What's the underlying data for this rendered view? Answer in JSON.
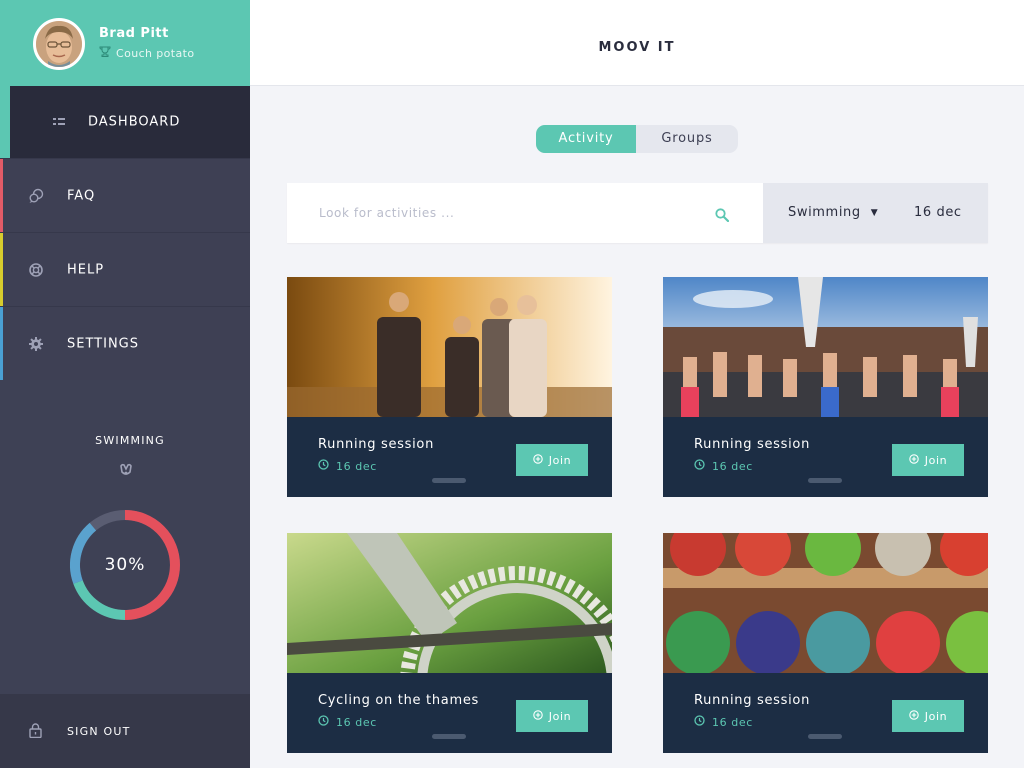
{
  "profile": {
    "name": "Brad Pitt",
    "role": "Couch potato"
  },
  "nav": {
    "dashboard": "DASHBOARD",
    "faq": "FAQ",
    "help": "HELP",
    "settings": "SETTINGS",
    "signout": "SIGN OUT"
  },
  "stats": {
    "title": "SWIMMING",
    "progress_label": "30%",
    "progress": 0.3
  },
  "header": {
    "brand": "MOOV  IT"
  },
  "tabs": {
    "activity": "Activity",
    "groups": "Groups",
    "selected": "Activity"
  },
  "search": {
    "placeholder": "Look for activities ...",
    "value": ""
  },
  "filter": {
    "category": "Swimming",
    "date": "16 dec"
  },
  "cards": [
    {
      "title": "Running session",
      "date": "16 dec",
      "join": "Join"
    },
    {
      "title": "Running session",
      "date": "16 dec",
      "join": "Join"
    },
    {
      "title": "Cycling on the thames",
      "date": "16 dec",
      "join": "Join"
    },
    {
      "title": "Running session",
      "date": "16 dec",
      "join": "Join"
    }
  ],
  "colors": {
    "accent": "#5cc7b2",
    "sidebar": "#3e4054",
    "card": "#1c2d44",
    "faq_bar": "#e25b67",
    "help_bar": "#d7cc2d",
    "settings_bar": "#4aa0d3",
    "donut_red": "#e4505c",
    "donut_teal": "#5cc7b2",
    "donut_blue": "#5aa2ce",
    "donut_track": "#5a5d72"
  }
}
